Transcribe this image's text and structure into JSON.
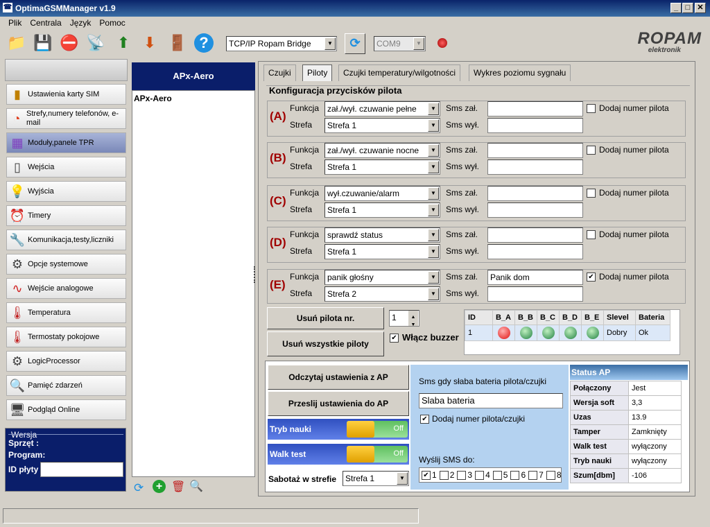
{
  "window": {
    "title": "OptimaGSMManager v1.9"
  },
  "menu": [
    "Plik",
    "Centrala",
    "Język",
    "Pomoc"
  ],
  "toolbar": {
    "connection": "TCP/IP Ropam Bridge",
    "port": "COM9",
    "brand": "ROPAM",
    "brand_sub": "elektronik"
  },
  "sidebar": {
    "items": [
      {
        "label": "Ustawienia karty SIM",
        "icon": "sim-card-icon"
      },
      {
        "label": "Strefy,numery telefonów, e-mail",
        "icon": "pie-chart-icon"
      },
      {
        "label": "Moduły,panele TPR",
        "icon": "cubes-icon"
      },
      {
        "label": "Wejścia",
        "icon": "motion-sensor-icon"
      },
      {
        "label": "Wyjścia",
        "icon": "lightbulb-icon"
      },
      {
        "label": "Timery",
        "icon": "alarm-clock-icon"
      },
      {
        "label": "Komunikacja,testy,liczniki",
        "icon": "tools-icon"
      },
      {
        "label": "Opcje systemowe",
        "icon": "gear-icon"
      },
      {
        "label": "Wejście analogowe",
        "icon": "waveform-icon"
      },
      {
        "label": "Temperatura",
        "icon": "thermometer-icon"
      },
      {
        "label": "Termostaty pokojowe",
        "icon": "thermostat-icon"
      },
      {
        "label": "LogicProcessor",
        "icon": "logic-icon"
      },
      {
        "label": "Pamięć zdarzeń",
        "icon": "magnifier-icon"
      },
      {
        "label": "Podgląd Online",
        "icon": "monitor-icon"
      }
    ],
    "version_group": "Wersja",
    "hw_label": "Sprzęt :",
    "program_label": "Program:",
    "board_id_label": "ID płyty"
  },
  "modules": {
    "header": "APx-Aero",
    "items": [
      "APx-Aero"
    ]
  },
  "tabs": [
    "Czujki",
    "Piloty",
    "Czujki temperatury/wilgotności",
    "Wykres poziomu sygnału"
  ],
  "remote": {
    "title": "Konfiguracja przycisków pilota",
    "function_label": "Funkcja",
    "zone_label": "Strefa",
    "sms_on_label": "Sms zał.",
    "sms_off_label": "Sms wył.",
    "add_number_label": "Dodaj numer pilota",
    "buttons": [
      {
        "letter": "(A)",
        "function": "zał./wył. czuwanie pełne",
        "zone": "Strefa 1",
        "sms_on": "",
        "sms_off": "",
        "add_number": false
      },
      {
        "letter": "(B)",
        "function": "zał./wył. czuwanie nocne",
        "zone": "Strefa 1",
        "sms_on": "",
        "sms_off": "",
        "add_number": false
      },
      {
        "letter": "(C)",
        "function": "wył.czuwanie/alarm",
        "zone": "Strefa 1",
        "sms_on": "",
        "sms_off": "",
        "add_number": false
      },
      {
        "letter": "(D)",
        "function": "sprawdź status",
        "zone": "Strefa 1",
        "sms_on": "",
        "sms_off": "",
        "add_number": false
      },
      {
        "letter": "(E)",
        "function": "panik głośny",
        "zone": "Strefa 2",
        "sms_on": "Panik dom",
        "sms_off": "",
        "add_number": true
      }
    ],
    "delete_label": "Usuń pilota nr.",
    "delete_all_label": "Usuń wszystkie piloty",
    "pilot_number": "1",
    "buzzer_label": "Włącz buzzer",
    "buzzer": true
  },
  "pilot_table": {
    "headers": [
      "ID",
      "B_A",
      "B_B",
      "B_C",
      "B_D",
      "B_E",
      "Slevel",
      "Bateria"
    ],
    "rows": [
      {
        "id": "1",
        "leds": [
          "red",
          "green",
          "green",
          "green",
          "green"
        ],
        "slevel": "Dobry",
        "battery": "Ok"
      }
    ]
  },
  "ap": {
    "read_label": "Odczytaj ustawienia z AP",
    "send_label": "Przeslij ustawienia do AP",
    "learn_label": "Tryb nauki",
    "learn_state": "Off",
    "walk_label": "Walk test",
    "walk_state": "Off",
    "sabotage_label": "Sabotaż w strefie",
    "sabotage_zone": "Strefa 1",
    "low_batt_label": "Sms gdy słaba bateria pilota/czujki",
    "low_batt_text": "Slaba bateria",
    "add_num_label": "Dodaj numer pilota/czujki",
    "send_to_label": "Wyślij SMS do:",
    "recipients": [
      {
        "n": "1",
        "on": true
      },
      {
        "n": "2",
        "on": false
      },
      {
        "n": "3",
        "on": false
      },
      {
        "n": "4",
        "on": false
      },
      {
        "n": "5",
        "on": false
      },
      {
        "n": "6",
        "on": false
      },
      {
        "n": "7",
        "on": false
      },
      {
        "n": "8",
        "on": false
      }
    ]
  },
  "status": {
    "title": "Status AP",
    "rows": [
      {
        "k": "Połączony",
        "v": "Jest"
      },
      {
        "k": "Wersja soft",
        "v": "3,3"
      },
      {
        "k": "Uzas",
        "v": "13.9"
      },
      {
        "k": "Tamper",
        "v": "Zamknięty"
      },
      {
        "k": "Walk test",
        "v": "wyłączony"
      },
      {
        "k": "Tryb nauki",
        "v": "wyłączony"
      },
      {
        "k": "Szum[dbm]",
        "v": "-106"
      }
    ]
  }
}
